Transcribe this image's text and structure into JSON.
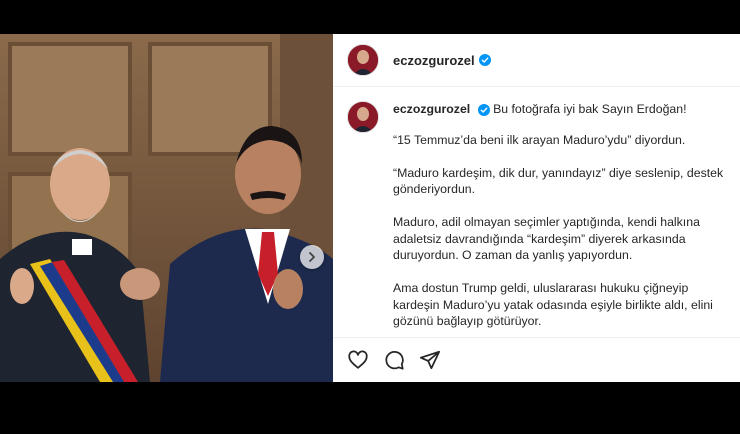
{
  "post": {
    "username": "eczozgurozel",
    "verified": true,
    "caption_lines": [
      "Bu fotoğrafa iyi bak Sayın Erdoğan!",
      "“15 Temmuz’da beni ilk arayan Maduro’ydu” diyordun.",
      "“Maduro kardeşim, dik dur, yanındayız” diye seslenip, destek gönderiyordun.",
      "Maduro, adil olmayan seçimler yaptığında, kendi halkına adaletsiz davrandığında “kardeşim” diyerek arkasında duruyordun. O zaman da yanlış yapıyordun.",
      "Ama dostun Trump geldi, uluslararası hukuku çiğneyip kardeşin Maduro’yu yatak odasında eşiyle birlikte aldı, elini gözünü bağlayıp götürüyor."
    ]
  },
  "icons": {
    "verified": "verified-badge-icon",
    "like": "heart-icon",
    "comment": "comment-icon",
    "share": "paper-plane-icon",
    "next": "chevron-right-icon"
  },
  "colors": {
    "verified_blue": "#0095f6",
    "text": "#262626",
    "divider": "#efefef"
  }
}
